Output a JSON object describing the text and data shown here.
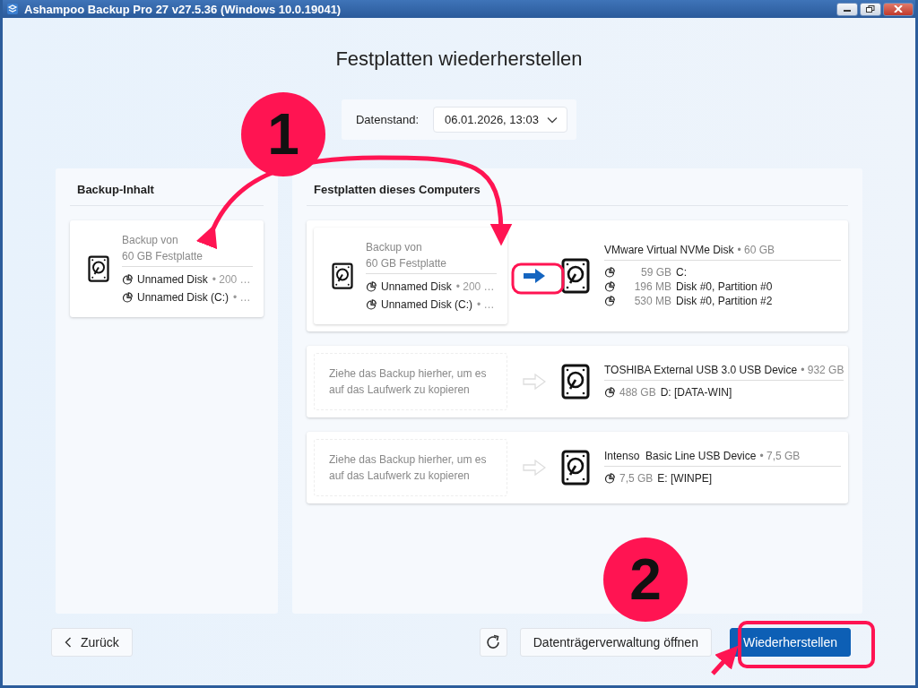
{
  "window": {
    "title": "Ashampoo Backup Pro 27 v27.5.36 (Windows 10.0.19041)"
  },
  "heading": "Festplatten wiederherstellen",
  "date_stand": {
    "label": "Datenstand:",
    "value": "06.01.2026, 13:03"
  },
  "backup_content": {
    "title": "Backup-Inhalt",
    "card": {
      "line1": "Backup von",
      "line2": "60 GB Festplatte",
      "partitions": [
        {
          "name": "Unnamed Disk",
          "detail": "• 200 …"
        },
        {
          "name": "Unnamed Disk (C:)",
          "detail": "• …"
        }
      ]
    }
  },
  "computer_disks": {
    "title": "Festplatten dieses Computers",
    "disks": [
      {
        "slot": {
          "kind": "backup",
          "line1": "Backup von",
          "line2": "60 GB Festplatte",
          "partitions": [
            {
              "name": "Unnamed Disk",
              "detail": "• 200 …"
            },
            {
              "name": "Unnamed Disk (C:)",
              "detail": "• …"
            }
          ]
        },
        "name": "VMware Virtual NVMe Disk",
        "size": "• 60 GB",
        "partitions": [
          {
            "size": "59 GB",
            "label": "C:"
          },
          {
            "size": "196 MB",
            "label": "Disk #0, Partition #0"
          },
          {
            "size": "530 MB",
            "label": "Disk #0, Partition #2"
          }
        ]
      },
      {
        "slot": {
          "kind": "drop",
          "hint": "Ziehe das Backup hierher, um es auf das Laufwerk zu kopieren"
        },
        "name": "TOSHIBA External USB 3.0 USB Device",
        "size": "• 932 GB",
        "partitions": [
          {
            "size": "488 GB",
            "label": "D: [DATA-WIN]"
          }
        ]
      },
      {
        "slot": {
          "kind": "drop",
          "hint": "Ziehe das Backup hierher, um es auf das Laufwerk zu kopieren"
        },
        "name": "Intenso  Basic Line USB Device",
        "size": "• 7,5 GB",
        "partitions": [
          {
            "size": "7,5 GB",
            "label": "E: [WINPE]"
          }
        ]
      }
    ]
  },
  "buttons": {
    "back": "Zurück",
    "disk_management": "Datenträgerverwaltung öffnen",
    "restore": "Wiederherstellen"
  },
  "annotations": [
    {
      "label": "1"
    },
    {
      "label": "2"
    }
  ]
}
